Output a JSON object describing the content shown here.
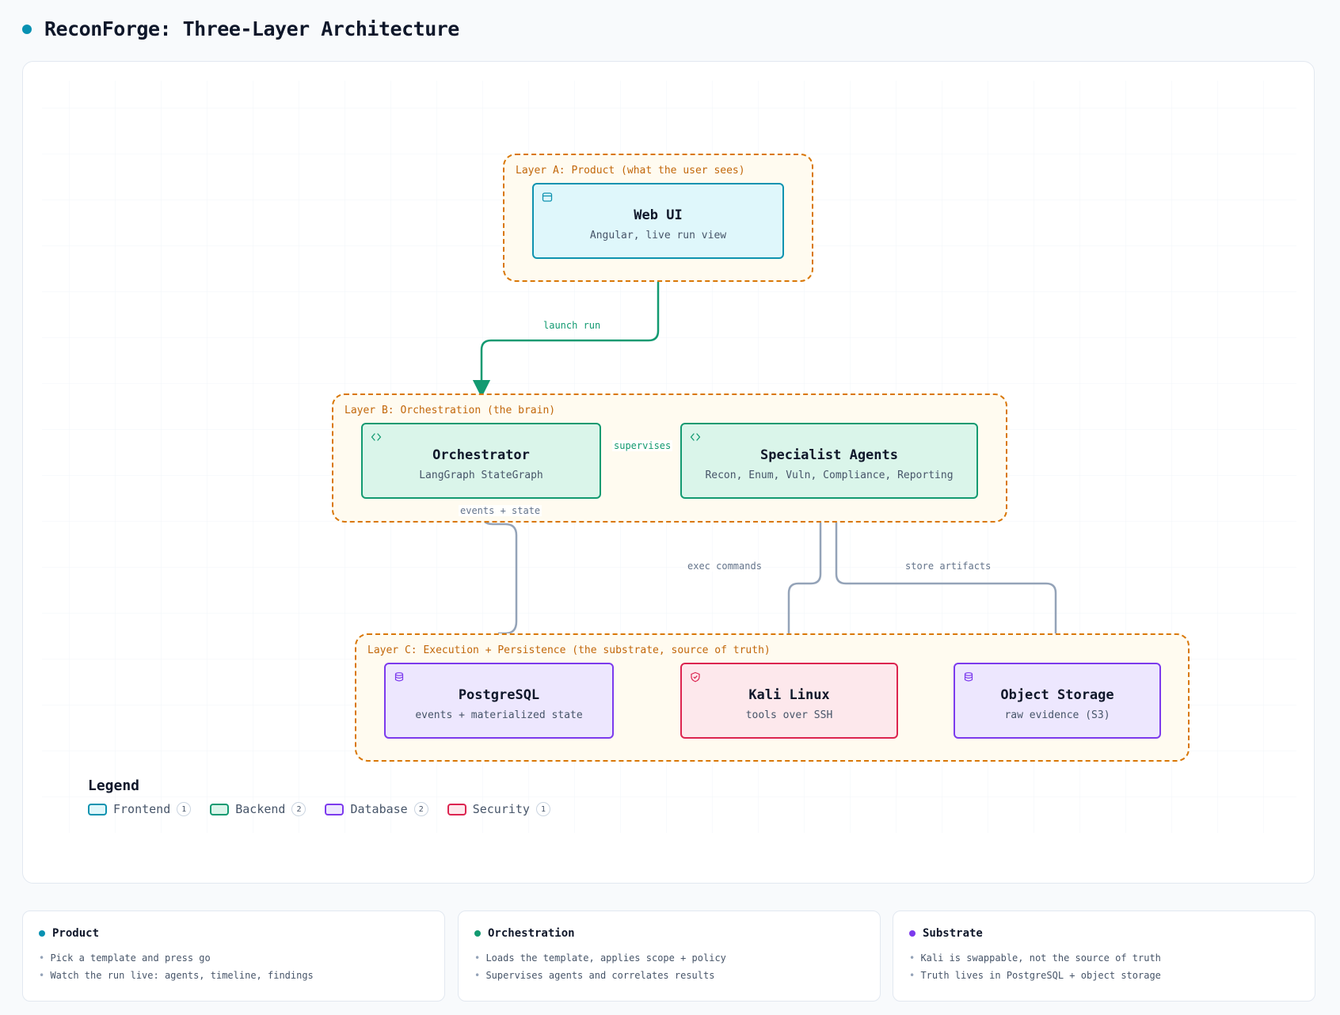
{
  "title": "ReconForge: Three-Layer Architecture",
  "colors": {
    "accent": "#0891b2",
    "group_border": "#d97706",
    "frontend": "#0e93b0",
    "backend": "#129a71",
    "database": "#7c3aed",
    "security": "#dc2450",
    "edge_gray": "#94a3b8"
  },
  "groups": [
    {
      "id": "layer-a",
      "label": "Layer A: Product (what the user sees)"
    },
    {
      "id": "layer-b",
      "label": "Layer B: Orchestration (the brain)"
    },
    {
      "id": "layer-c",
      "label": "Layer C: Execution + Persistence (the substrate, source of truth)"
    }
  ],
  "nodes": {
    "web_ui": {
      "title": "Web UI",
      "subtitle": "Angular, live run view",
      "category": "Frontend",
      "icon": "window-icon"
    },
    "orchestrator": {
      "title": "Orchestrator",
      "subtitle": "LangGraph StateGraph",
      "category": "Backend",
      "icon": "code-icon"
    },
    "specialist_agents": {
      "title": "Specialist Agents",
      "subtitle": "Recon, Enum, Vuln, Compliance, Reporting",
      "category": "Backend",
      "icon": "code-icon"
    },
    "postgresql": {
      "title": "PostgreSQL",
      "subtitle": "events + materialized state",
      "category": "Database",
      "icon": "database-icon"
    },
    "kali_linux": {
      "title": "Kali Linux",
      "subtitle": "tools over SSH",
      "category": "Security",
      "icon": "shield-icon"
    },
    "object_storage": {
      "title": "Object Storage",
      "subtitle": "raw evidence (S3)",
      "category": "Database",
      "icon": "database-icon"
    }
  },
  "edges": [
    {
      "from": "web_ui",
      "to": "orchestrator",
      "label": "launch run",
      "style": "green"
    },
    {
      "from": "orchestrator",
      "to": "specialist_agents",
      "label": "supervises",
      "style": "green"
    },
    {
      "from": "orchestrator",
      "to": "postgresql",
      "label": "events + state",
      "style": "gray"
    },
    {
      "from": "specialist_agents",
      "to": "kali_linux",
      "label": "exec commands",
      "style": "gray"
    },
    {
      "from": "specialist_agents",
      "to": "object_storage",
      "label": "store artifacts",
      "style": "gray"
    }
  ],
  "legend": {
    "title": "Legend",
    "items": [
      {
        "label": "Frontend",
        "count": "1"
      },
      {
        "label": "Backend",
        "count": "2"
      },
      {
        "label": "Database",
        "count": "2"
      },
      {
        "label": "Security",
        "count": "1"
      }
    ]
  },
  "cards": [
    {
      "title": "Product",
      "color": "#0891b2",
      "bullets": [
        "Pick a template and press go",
        "Watch the run live: agents, timeline, findings"
      ]
    },
    {
      "title": "Orchestration",
      "color": "#129a71",
      "bullets": [
        "Loads the template, applies scope + policy",
        "Supervises agents and correlates results"
      ]
    },
    {
      "title": "Substrate",
      "color": "#7c3aed",
      "bullets": [
        "Kali is swappable, not the source of truth",
        "Truth lives in PostgreSQL + object storage"
      ]
    }
  ]
}
